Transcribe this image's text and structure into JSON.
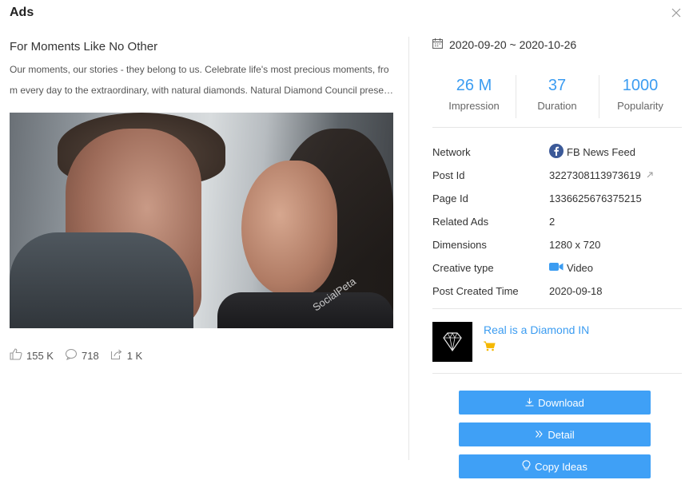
{
  "modal": {
    "title": "Ads"
  },
  "ad": {
    "title": "For Moments Like No Other",
    "description_line1": "Our moments, our stories - they belong to us. Celebrate life's most precious moments, fro",
    "description_line2": "m every day to the extraordinary, with natural diamonds. Natural Diamond Council presents...",
    "watermark": "SocialPeta"
  },
  "engagement": {
    "likes": "155 K",
    "comments": "718",
    "shares": "1 K"
  },
  "date_range": "2020-09-20 ~ 2020-10-26",
  "metrics": [
    {
      "value": "26 M",
      "label": "Impression"
    },
    {
      "value": "37",
      "label": "Duration"
    },
    {
      "value": "1000",
      "label": "Popularity"
    }
  ],
  "details": {
    "network_label": "Network",
    "network_value": "FB News Feed",
    "post_id_label": "Post Id",
    "post_id_value": "3227308113973619",
    "page_id_label": "Page Id",
    "page_id_value": "1336625676375215",
    "related_ads_label": "Related Ads",
    "related_ads_value": "2",
    "dimensions_label": "Dimensions",
    "dimensions_value": "1280 x 720",
    "creative_type_label": "Creative type",
    "creative_type_value": "Video",
    "post_created_label": "Post Created Time",
    "post_created_value": "2020-09-18"
  },
  "advertiser": {
    "name": "Real is a Diamond IN"
  },
  "buttons": {
    "download": "Download",
    "detail": "Detail",
    "copy_ideas": "Copy Ideas"
  },
  "colors": {
    "accent": "#3b9cf1",
    "button": "#3fa0f6",
    "facebook": "#3b5998",
    "cart": "#f5b800"
  },
  "icons": {
    "close": "close-icon",
    "calendar": "calendar-icon",
    "like": "thumbs-up-icon",
    "comment": "comment-icon",
    "share": "share-icon",
    "facebook": "facebook-icon",
    "external": "external-link-icon",
    "video": "video-camera-icon",
    "cart": "shopping-cart-icon",
    "download": "download-icon",
    "detail": "double-chevron-right-icon",
    "copy": "lightbulb-icon"
  }
}
